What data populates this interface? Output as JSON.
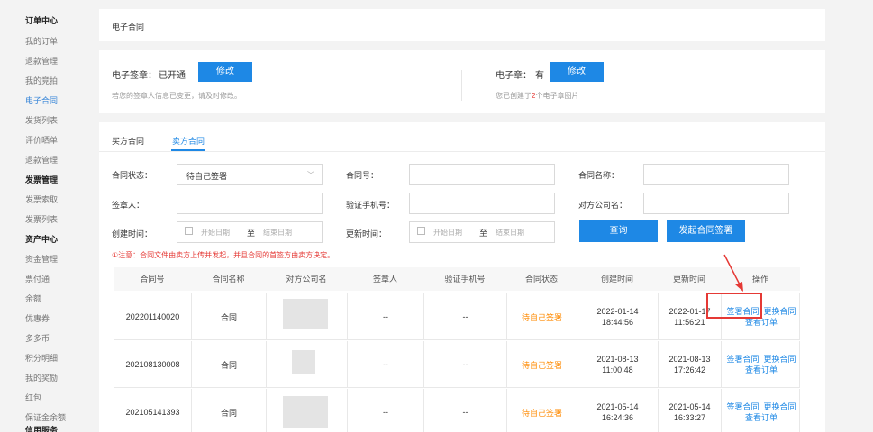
{
  "sidebar": {
    "items": [
      {
        "label": "订单中心",
        "kind": "header"
      },
      {
        "label": "我的订单"
      },
      {
        "label": "退款管理"
      },
      {
        "label": "我的竞拍"
      },
      {
        "label": "电子合同",
        "active": true
      },
      {
        "label": "发货列表"
      },
      {
        "label": "评价晒单"
      },
      {
        "label": "退款管理"
      },
      {
        "label": "发票管理",
        "kind": "header"
      },
      {
        "label": "发票索取"
      },
      {
        "label": "发票列表"
      },
      {
        "label": "资产中心",
        "kind": "header"
      },
      {
        "label": "资金管理"
      },
      {
        "label": "票付通"
      },
      {
        "label": "余额"
      },
      {
        "label": "优惠券"
      },
      {
        "label": "多多币"
      },
      {
        "label": "积分明细"
      },
      {
        "label": "我的奖励"
      },
      {
        "label": "红包"
      },
      {
        "label": "保证金余额"
      },
      {
        "label": "信用服务",
        "kind": "header"
      }
    ]
  },
  "page": {
    "title": "电子合同"
  },
  "signature": {
    "label": "电子签章：",
    "status": "已开通",
    "modify_label": "修改",
    "hint": "若您的签章人信息已变更，请及时修改。"
  },
  "seal": {
    "label": "电子章：",
    "status": "有",
    "modify_label": "修改",
    "hint_prefix": "您已创建了",
    "hint_count": "2",
    "hint_suffix": "个电子章图片"
  },
  "tabs": [
    {
      "label": "买方合同",
      "active": false
    },
    {
      "label": "卖方合同",
      "active": true
    }
  ],
  "filters": {
    "status_label": "合同状态：",
    "status_value": "待自己签署",
    "contract_no_label": "合同号：",
    "contract_name_label": "合同名称：",
    "signer_label": "签章人：",
    "phone_label": "验证手机号：",
    "counterparty_label": "对方公司名：",
    "create_time_label": "创建时间：",
    "update_time_label": "更新时间：",
    "start_placeholder": "开始日期",
    "end_placeholder": "结束日期",
    "to_text": "至",
    "query_label": "查询",
    "initiate_label": "发起合同签署"
  },
  "notice": "①注意：合同文件由卖方上传并发起，并且合同的首签方由卖方决定。",
  "table": {
    "columns": [
      "合同号",
      "合同名称",
      "对方公司名",
      "签章人",
      "验证手机号",
      "合同状态",
      "创建时间",
      "更新时间",
      "操作"
    ],
    "rows": [
      {
        "contract_no": "202201140020",
        "name": "合同",
        "company": "",
        "signer": "--",
        "phone": "--",
        "status": "待自己签署",
        "created_date": "2022-01-14",
        "created_time": "18:44:56",
        "updated_date": "2022-01-17",
        "updated_time": "11:56:21"
      },
      {
        "contract_no": "202108130008",
        "name": "合同",
        "company": "",
        "signer": "--",
        "phone": "--",
        "status": "待自己签署",
        "created_date": "2021-08-13",
        "created_time": "11:00:48",
        "updated_date": "2021-08-13",
        "updated_time": "17:26:42"
      },
      {
        "contract_no": "202105141393",
        "name": "合同",
        "company": "",
        "signer": "--",
        "phone": "--",
        "status": "待自己签署",
        "created_date": "2021-05-14",
        "created_time": "16:24:36",
        "updated_date": "2021-05-14",
        "updated_time": "16:33:27"
      }
    ],
    "action_sign": "签署合同",
    "action_replace": "更换合同",
    "action_view": "查看订单"
  },
  "colors": {
    "accent": "#1e88e5",
    "warning": "#ff8a00",
    "alert": "#e53935"
  }
}
